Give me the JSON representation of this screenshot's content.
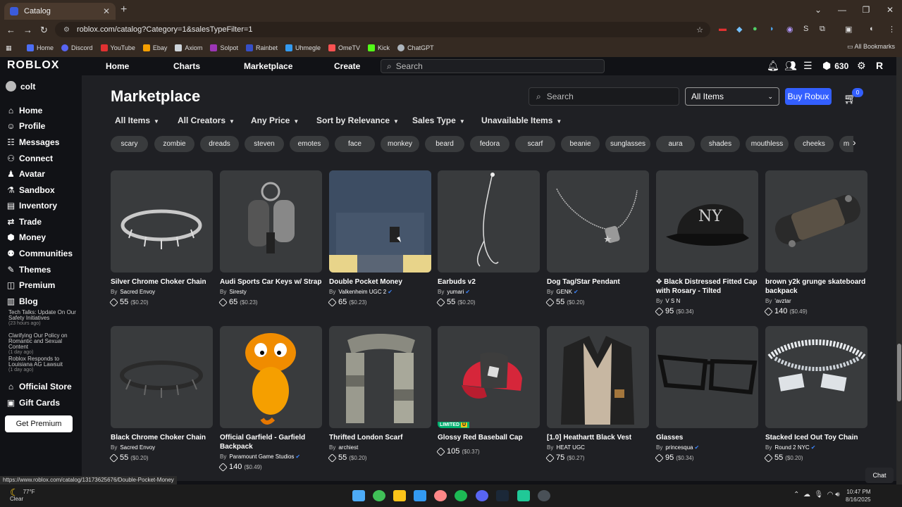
{
  "browser": {
    "tab_title": "Catalog",
    "url": "roblox.com/catalog?Category=1&salesTypeFilter=1",
    "bookmarks": [
      "Home",
      "Discord",
      "YouTube",
      "Ebay",
      "Axiom",
      "Solpot",
      "Rainbet",
      "Uhmegle",
      "OmeTV",
      "Kick",
      "ChatGPT"
    ],
    "all_bookmarks": "All Bookmarks",
    "status_url": "https://www.roblox.com/catalog/13173625676/Double-Pocket-Money"
  },
  "topbar": {
    "logo": "ROBLOX",
    "nav": [
      "Home",
      "Charts",
      "Marketplace",
      "Create"
    ],
    "search_placeholder": "Search",
    "robux": "630"
  },
  "sidebar": {
    "username": "colt",
    "items": [
      "Home",
      "Profile",
      "Messages",
      "Connect",
      "Avatar",
      "Sandbox",
      "Inventory",
      "Trade",
      "Money",
      "Communities",
      "Themes",
      "Premium",
      "Blog"
    ],
    "blog_posts": [
      {
        "title": "Tech Talks: Update On Our Safety Initiatives",
        "time": "(23 hours ago)"
      },
      {
        "title": "Clarifying Our Policy on Romantic and Sexual Content",
        "time": "(1 day ago)"
      },
      {
        "title": "Roblox Responds to Louisiana AG Lawsuit",
        "time": "(1 day ago)"
      }
    ],
    "official_store": "Official Store",
    "gift_cards": "Gift Cards",
    "get_premium": "Get Premium"
  },
  "marketplace": {
    "title": "Marketplace",
    "search_placeholder": "Search",
    "category_dropdown": "All Items",
    "buy_robux": "Buy Robux",
    "cart_count": "0",
    "filters": [
      "All Items",
      "All Creators",
      "Any Price",
      "Sort by Relevance",
      "Sales Type",
      "Unavailable Items"
    ],
    "chips": [
      "scary",
      "zombie",
      "dreads",
      "steven",
      "emotes",
      "face",
      "monkey",
      "beard",
      "fedora",
      "scarf",
      "beanie",
      "sunglasses",
      "aura",
      "shades",
      "mouthless",
      "cheeks",
      "m"
    ]
  },
  "items": [
    {
      "name": "Silver Chrome Choker Chain",
      "creator": "Sacred Envoy",
      "verified": false,
      "price": "55",
      "usd": "($0.20)"
    },
    {
      "name": "Audi Sports Car Keys w/ Strap",
      "creator": "Siresty",
      "verified": false,
      "price": "65",
      "usd": "($0.23)"
    },
    {
      "name": "Double Pocket Money",
      "creator": "Valkenheim UGC 2",
      "verified": true,
      "price": "65",
      "usd": "($0.23)"
    },
    {
      "name": "Earbuds v2",
      "creator": "yumari",
      "verified": true,
      "price": "55",
      "usd": "($0.20)"
    },
    {
      "name": "Dog Tag/Star Pendant",
      "creator": "GENK",
      "verified": true,
      "price": "55",
      "usd": "($0.20)"
    },
    {
      "name": "✥ Black Distressed Fitted Cap with Rosary - Tilted",
      "creator": "V S N",
      "verified": false,
      "price": "95",
      "usd": "($0.34)"
    },
    {
      "name": "brown y2k grunge skateboard backpack",
      "creator": "'avztar",
      "verified": false,
      "price": "140",
      "usd": "($0.49)"
    },
    {
      "name": "Black Chrome Choker Chain",
      "creator": "Sacred Envoy",
      "verified": false,
      "price": "55",
      "usd": "($0.20)"
    },
    {
      "name": "Official Garfield - Garfield Backpack",
      "creator": "Paramount Game Studios",
      "verified": true,
      "price": "140",
      "usd": "($0.49)"
    },
    {
      "name": "Thrifted London Scarf",
      "creator": "archiest",
      "verified": false,
      "price": "55",
      "usd": "($0.20)"
    },
    {
      "name": "Glossy Red Baseball Cap",
      "creator": "",
      "verified": false,
      "price": "105",
      "usd": "($0.37)",
      "limited": "LIMITED",
      "limited_u": "U"
    },
    {
      "name": "[1.0] Heathartt Black Vest",
      "creator": "HEAT UGC",
      "verified": false,
      "price": "75",
      "usd": "($0.27)"
    },
    {
      "name": "Glasses",
      "creator": "princesqua",
      "verified": true,
      "price": "95",
      "usd": "($0.34)"
    },
    {
      "name": "Stacked Iced Out Toy Chain",
      "creator": "Round 2 NYC",
      "verified": true,
      "price": "55",
      "usd": "($0.20)"
    }
  ],
  "chat_label": "Chat",
  "taskbar": {
    "weather_temp": "77°F",
    "weather_desc": "Clear",
    "time": "10:47 PM",
    "date": "8/16/2025"
  }
}
